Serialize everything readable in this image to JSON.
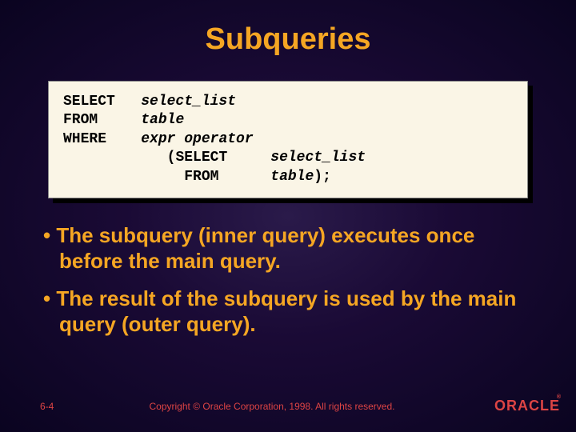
{
  "title": "Subqueries",
  "code": {
    "kw_select": "SELECT",
    "kw_from": "FROM",
    "kw_where": "WHERE",
    "it_select_list": "select_list",
    "it_table": "table",
    "it_expr_op": "expr operator",
    "paren_open": "(",
    "inner_select": "SELECT",
    "inner_from": "FROM",
    "inner_select_list": "select_list",
    "inner_table_close": "table",
    "close": ");"
  },
  "bullets": [
    "The subquery (inner query) executes once before the main query.",
    "The result of the subquery is used by the main query (outer query)."
  ],
  "footer": {
    "slide": "6-4",
    "copyright": "Copyright © Oracle Corporation, 1998. All rights reserved.",
    "logo": "ORACLE",
    "reg": "®"
  }
}
